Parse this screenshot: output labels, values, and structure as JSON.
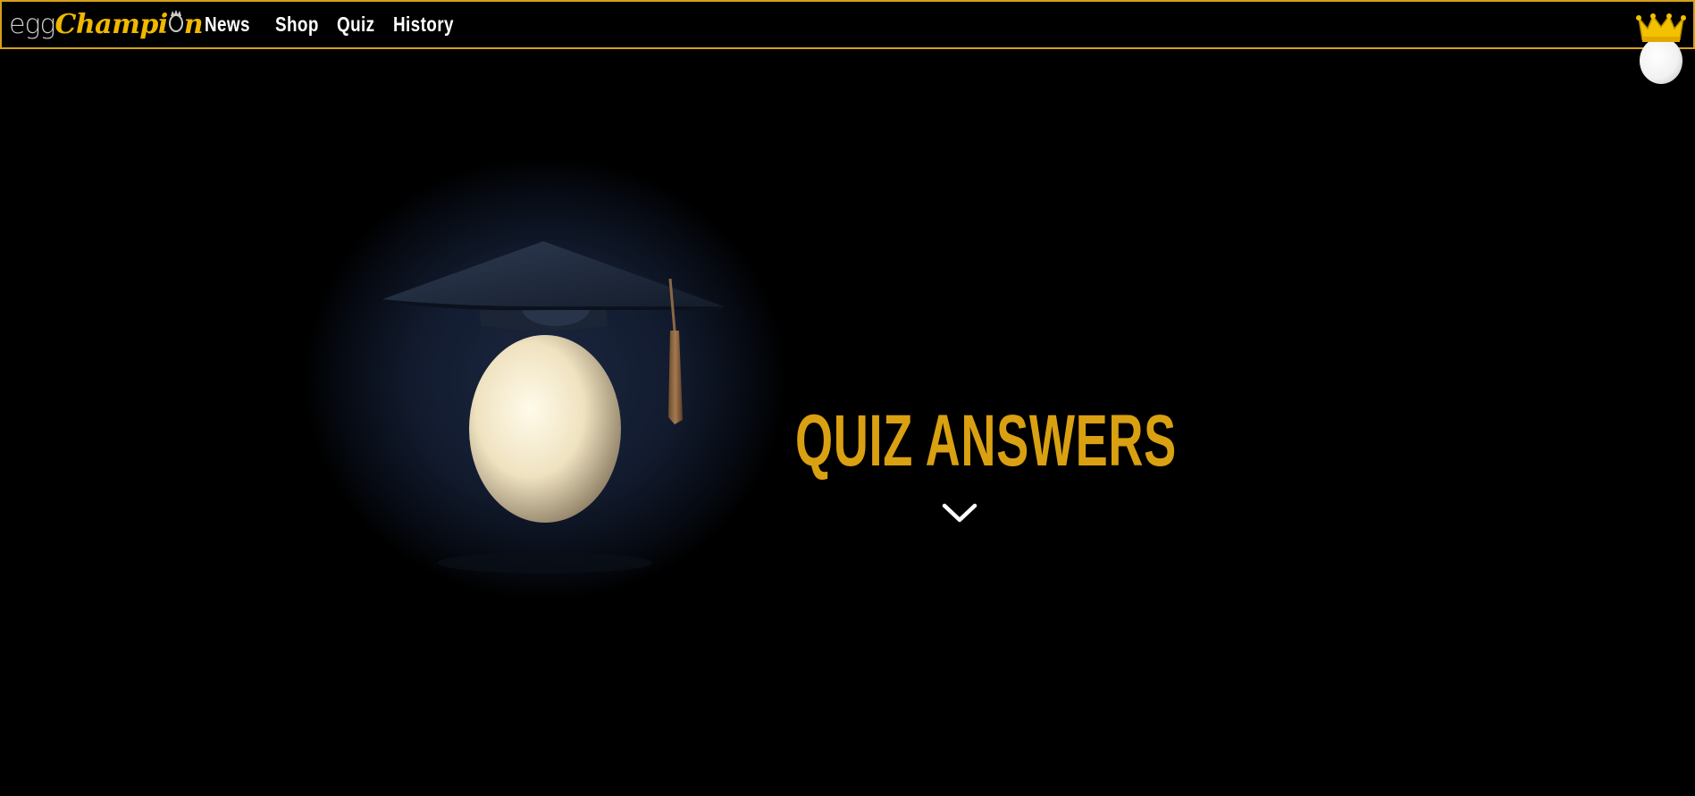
{
  "nav": {
    "logo": {
      "egg": "egg",
      "champion": "Champi",
      "champion_tail": "n"
    },
    "links": [
      "News",
      "Shop",
      "Quiz",
      "History"
    ]
  },
  "hero": {
    "title": "QUIZ ANSWERS",
    "image": "egg-with-graduation-cap",
    "scroll_icon": "chevron-down-icon"
  },
  "colors": {
    "accent": "#d9a011",
    "border": "#d4a017",
    "background": "#000000",
    "nav_text": "#ffffff"
  },
  "icons": {
    "user": "crowned-egg-icon",
    "scroll": "chevron-down-icon"
  }
}
